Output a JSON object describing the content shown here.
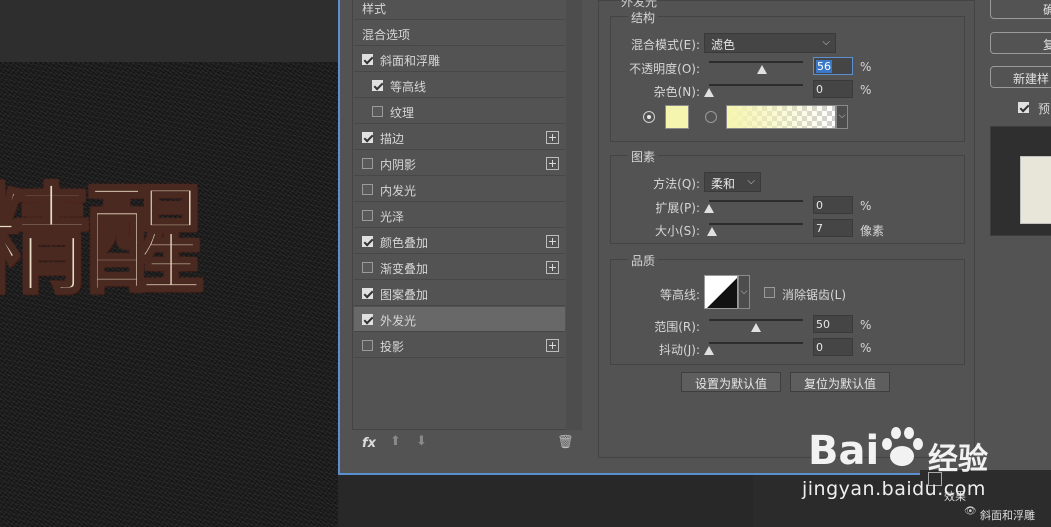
{
  "canvas": {
    "art_text": "精醒"
  },
  "style_list": {
    "items": [
      {
        "label": "样式",
        "checkbox": null,
        "plus": false,
        "indent": 0
      },
      {
        "label": "混合选项",
        "checkbox": null,
        "plus": false,
        "indent": 0
      },
      {
        "label": "斜面和浮雕",
        "checkbox": true,
        "plus": false,
        "indent": 0
      },
      {
        "label": "等高线",
        "checkbox": true,
        "plus": false,
        "indent": 1
      },
      {
        "label": "纹理",
        "checkbox": false,
        "plus": false,
        "indent": 1
      },
      {
        "label": "描边",
        "checkbox": true,
        "plus": true,
        "indent": 0
      },
      {
        "label": "内阴影",
        "checkbox": false,
        "plus": true,
        "indent": 0
      },
      {
        "label": "内发光",
        "checkbox": false,
        "plus": false,
        "indent": 0
      },
      {
        "label": "光泽",
        "checkbox": false,
        "plus": false,
        "indent": 0
      },
      {
        "label": "颜色叠加",
        "checkbox": true,
        "plus": true,
        "indent": 0
      },
      {
        "label": "渐变叠加",
        "checkbox": false,
        "plus": true,
        "indent": 0
      },
      {
        "label": "图案叠加",
        "checkbox": true,
        "plus": false,
        "indent": 0
      },
      {
        "label": "外发光",
        "checkbox": true,
        "plus": false,
        "indent": 0,
        "selected": true
      },
      {
        "label": "投影",
        "checkbox": false,
        "plus": true,
        "indent": 0
      }
    ],
    "footer": {
      "fx": "fx"
    }
  },
  "outer_glow": {
    "panel_title": "外发光",
    "structure": {
      "title": "结构",
      "blend_mode_label": "混合模式(E):",
      "blend_mode_value": "滤色",
      "opacity_label": "不透明度(O):",
      "opacity_value": "56",
      "opacity_pct": 56,
      "noise_label": "杂色(N):",
      "noise_value": "0",
      "noise_pct": 0,
      "unit": "%",
      "glow_color": "#f6f5b0"
    },
    "elements": {
      "title": "图素",
      "method_label": "方法(Q):",
      "method_value": "柔和",
      "spread_label": "扩展(P):",
      "spread_value": "0",
      "spread_pct": 0,
      "size_label": "大小(S):",
      "size_value": "7",
      "size_unit": "像素",
      "size_pct": 3.5
    },
    "quality": {
      "title": "品质",
      "contour_label": "等高线:",
      "antialias_label": "消除锯齿(L)",
      "range_label": "范围(R):",
      "range_value": "50",
      "range_pct": 50,
      "jitter_label": "抖动(J):",
      "jitter_value": "0",
      "jitter_pct": 0
    },
    "buttons": {
      "make_default": "设置为默认值",
      "reset_default": "复位为默认值"
    }
  },
  "right_buttons": {
    "ok": "确",
    "reset": "复",
    "new_style": "新建样",
    "preview": "预"
  },
  "layers": {
    "effects_label": "效果",
    "bevel_label": "斜面和浮雕"
  },
  "watermark": {
    "brand": "Bai",
    "brand_cn": "经验",
    "url": "jingyan.baidu.com"
  },
  "colors": {
    "accent": "#5a8fd0",
    "panel": "#535353"
  }
}
